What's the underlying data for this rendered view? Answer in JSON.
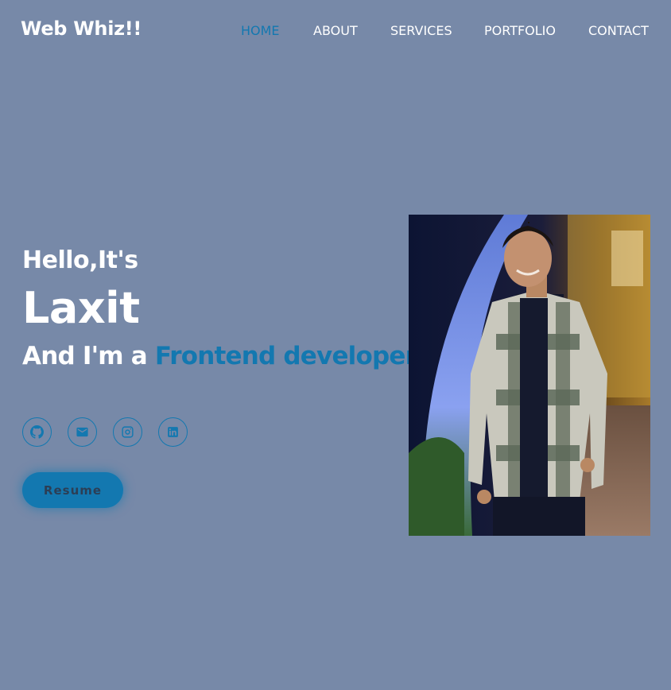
{
  "header": {
    "logo": "Web Whiz!!",
    "nav": [
      {
        "label": "HOME",
        "active": true
      },
      {
        "label": "ABOUT",
        "active": false
      },
      {
        "label": "SERVICES",
        "active": false
      },
      {
        "label": "PORTFOLIO",
        "active": false
      },
      {
        "label": "CONTACT",
        "active": false
      }
    ]
  },
  "hero": {
    "greeting": "Hello,It's",
    "name": "Laxit",
    "role_prefix": "And I'm a ",
    "role_text": "Frontend developer",
    "socials": [
      {
        "icon": "github-icon"
      },
      {
        "icon": "mail-icon"
      },
      {
        "icon": "instagram-icon"
      },
      {
        "icon": "linkedin-icon"
      }
    ],
    "resume_label": "Resume"
  },
  "colors": {
    "background": "#7789a8",
    "accent": "#1378b0",
    "text": "#ffffff",
    "button_text": "#2c3e55"
  }
}
